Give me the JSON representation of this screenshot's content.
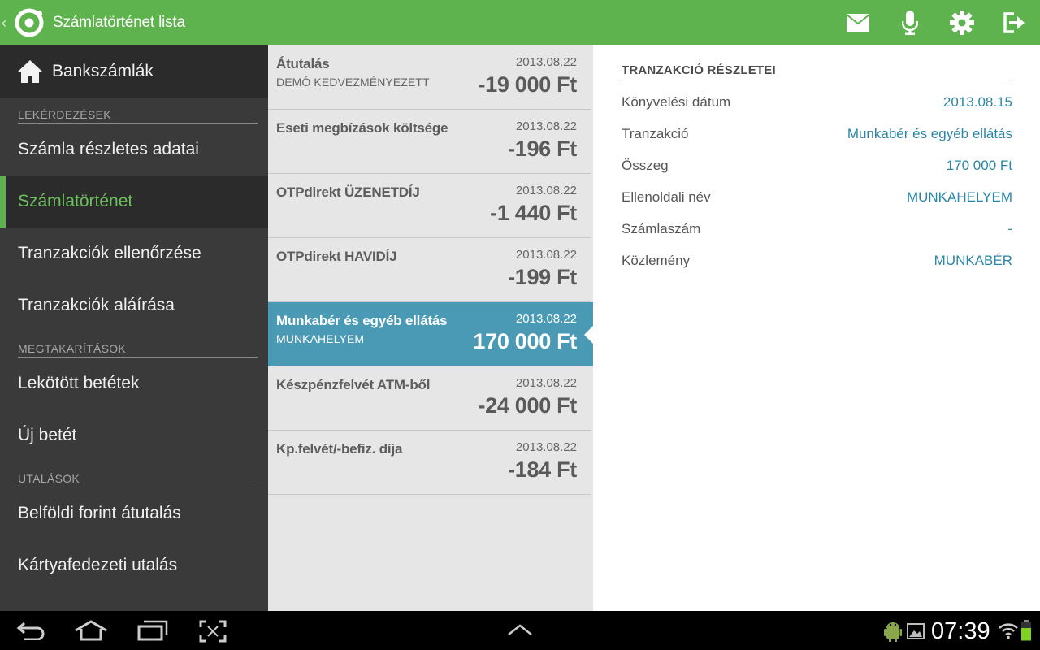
{
  "appbar": {
    "title": "Számlatörténet lista",
    "back_glyph": "‹",
    "brand_color": "#5fb34f",
    "actions": [
      {
        "name": "mail-icon"
      },
      {
        "name": "microphone-icon"
      },
      {
        "name": "gear-icon"
      },
      {
        "name": "logout-icon"
      }
    ]
  },
  "nav": {
    "home_label": "Bankszámlák",
    "sections": [
      {
        "title": "LEKÉRDEZÉSEK",
        "items": [
          "Számla részletes adatai",
          "Számlatörténet",
          "Tranzakciók ellenőrzése",
          "Tranzakciók aláírása"
        ]
      },
      {
        "title": "MEGTAKARÍTÁSOK",
        "items": [
          "Lekötött betétek",
          "Új betét"
        ]
      },
      {
        "title": "UTALÁSOK",
        "items": [
          "Belföldi forint átutalás",
          "Kártyafedezeti utalás"
        ]
      }
    ],
    "active_item": "Számlatörténet"
  },
  "transactions": [
    {
      "name": "Átutalás",
      "sub": "DEMÓ KEDVEZMÉNYEZETT",
      "date": "2013.08.22",
      "amount": "-19 000 Ft"
    },
    {
      "name": "Eseti megbízások költsége",
      "sub": "",
      "date": "2013.08.22",
      "amount": "-196 Ft"
    },
    {
      "name": "OTPdirekt ÜZENETDÍJ",
      "sub": "",
      "date": "2013.08.22",
      "amount": "-1 440 Ft"
    },
    {
      "name": "OTPdirekt HAVIDÍJ",
      "sub": "",
      "date": "2013.08.22",
      "amount": "-199 Ft"
    },
    {
      "name": "Munkabér és egyéb ellátás",
      "sub": "MUNKAHELYEM",
      "date": "2013.08.22",
      "amount": "170 000 Ft",
      "selected": true
    },
    {
      "name": "Készpénzfelvét ATM-ből",
      "sub": "",
      "date": "2013.08.22",
      "amount": "-24 000 Ft"
    },
    {
      "name": "Kp.felvét/-befiz. díja",
      "sub": "",
      "date": "2013.08.22",
      "amount": "-184 Ft"
    }
  ],
  "details": {
    "title": "TRANZAKCIÓ RÉSZLETEI",
    "rows": [
      {
        "label": "Könyvelési dátum",
        "value": "2013.08.15"
      },
      {
        "label": "Tranzakció",
        "value": "Munkabér és egyéb ellátás"
      },
      {
        "label": "Összeg",
        "value": "170 000 Ft"
      },
      {
        "label": "Ellenoldali név",
        "value": "MUNKAHELYEM"
      },
      {
        "label": "Számlaszám",
        "value": "-"
      },
      {
        "label": "Közlemény",
        "value": "MUNKABÉR"
      }
    ]
  },
  "systembar": {
    "clock": "07:39",
    "buttons": [
      "back-icon",
      "home-icon",
      "recent-apps-icon",
      "screenshot-icon",
      "chevron-up-icon"
    ],
    "status_icons": [
      "android-debug-icon",
      "image-notification-icon",
      "wifi-icon",
      "battery-icon"
    ],
    "battery_color": "#7ed321"
  }
}
